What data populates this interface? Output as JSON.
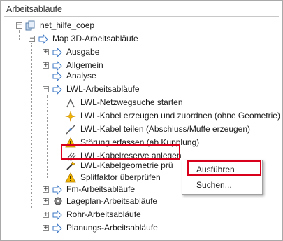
{
  "panel": {
    "title": "Arbeitsabläufe"
  },
  "tree": {
    "root": "net_hilfe_coep",
    "map3d": "Map 3D-Arbeitsabläufe",
    "ausgabe": "Ausgabe",
    "allgemein": "Allgemein",
    "analyse": "Analyse",
    "lwl": "LWL-Arbeitsabläufe",
    "lwl_items": [
      "LWL-Netzwegsuche starten",
      "LWL-Kabel erzeugen und zuordnen (ohne Geometrie)",
      "LWL-Kabel teilen (Abschluss/Muffe erzeugen)",
      "Störung erfassen (ab Kupplung)",
      "LWL-Kabelreserve anlegen",
      "LWL-Kabelgeometrie prü",
      "Splitfaktor überprüfen"
    ],
    "fm": "Fm-Arbeitsabläufe",
    "lageplan": "Lageplan-Arbeitsabläufe",
    "rohr": "Rohr-Arbeitsabläufe",
    "planung": "Planungs-Arbeitsabläufe"
  },
  "context_menu": {
    "items": [
      "Ausführen",
      "Suchen..."
    ]
  },
  "colors": {
    "highlight": "#d9001b",
    "arrow": "#3a76c4",
    "warning": "#f2b600"
  }
}
